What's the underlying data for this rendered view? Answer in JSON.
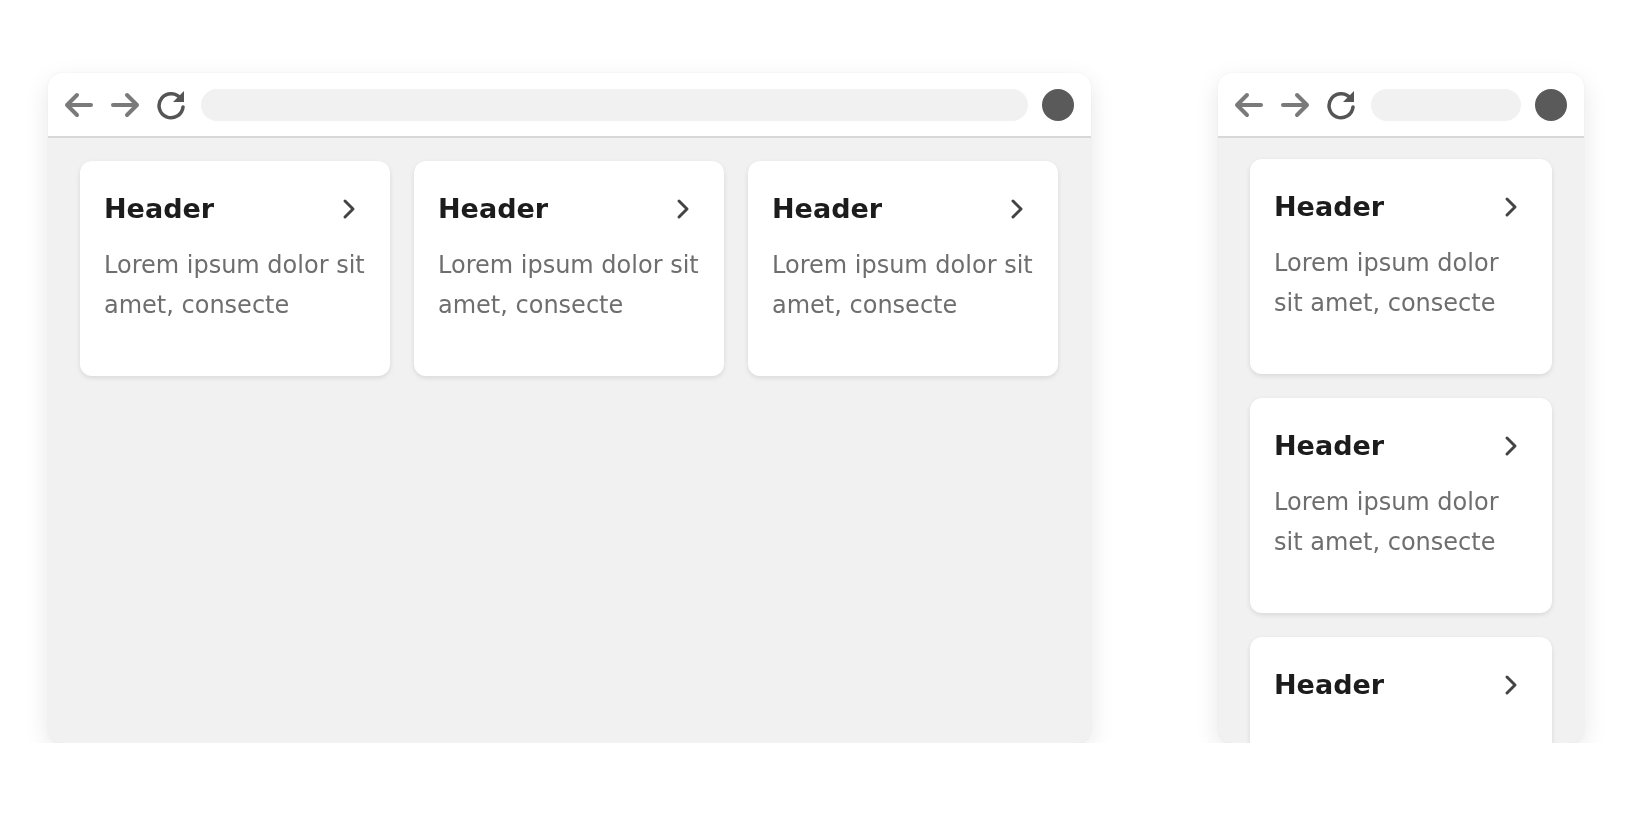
{
  "windows": [
    {
      "kind": "wide",
      "cards": [
        {
          "header": "Header",
          "body": "Lorem ipsum dolor sit amet, consecte"
        },
        {
          "header": "Header",
          "body": "Lorem ipsum dolor sit amet, consecte"
        },
        {
          "header": "Header",
          "body": "Lorem ipsum dolor sit amet, consecte"
        }
      ]
    },
    {
      "kind": "narrow",
      "cards": [
        {
          "header": "Header",
          "body": "Lorem ipsum dolor sit amet, consecte"
        },
        {
          "header": "Header",
          "body": "Lorem ipsum dolor sit amet, consecte"
        },
        {
          "header": "Header"
        }
      ]
    }
  ]
}
